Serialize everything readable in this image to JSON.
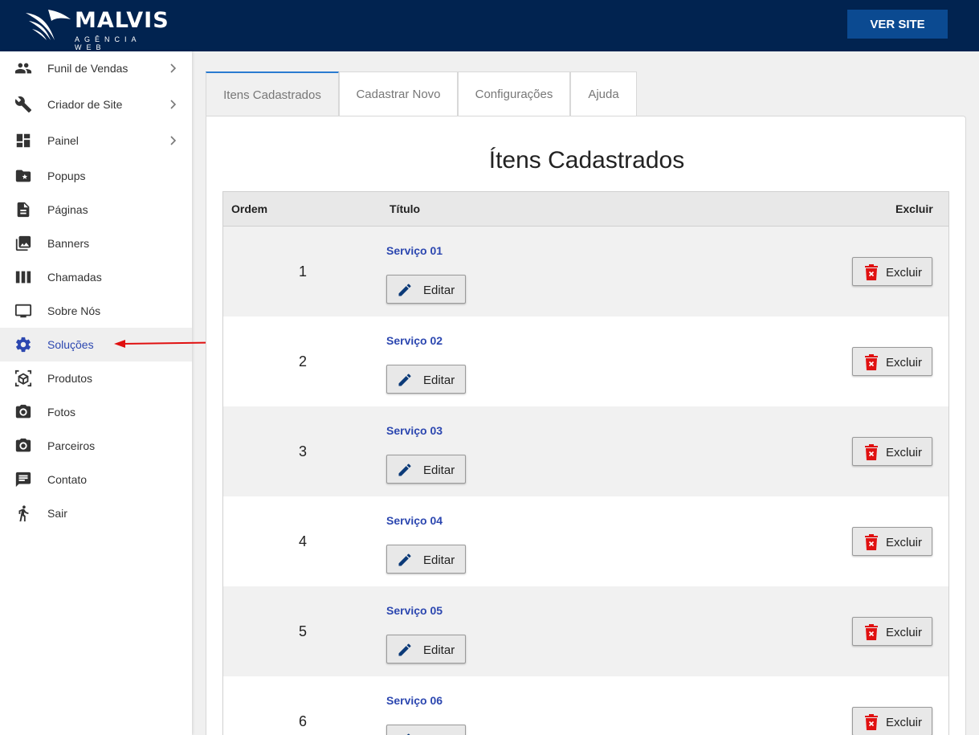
{
  "brand": {
    "name": "MALVIS",
    "tagline": "AGÊNCIA WEB"
  },
  "header": {
    "ver_site": "VER SITE"
  },
  "colors": {
    "topbar": "#012350",
    "accent": "#0b4a91",
    "link": "#2c47b0",
    "danger": "#e01010"
  },
  "sidebar": {
    "items": [
      {
        "label": "Funil de Vendas",
        "icon": "people-icon",
        "has_submenu": true
      },
      {
        "label": "Criador de Site",
        "icon": "wrench-icon",
        "has_submenu": true
      },
      {
        "label": "Painel",
        "icon": "dashboard-icon",
        "has_submenu": true
      },
      {
        "label": "Popups",
        "icon": "folder-star-icon"
      },
      {
        "label": "Páginas",
        "icon": "document-icon"
      },
      {
        "label": "Banners",
        "icon": "photo-library-icon"
      },
      {
        "label": "Chamadas",
        "icon": "columns-icon"
      },
      {
        "label": "Sobre Nós",
        "icon": "monitor-icon"
      },
      {
        "label": "Soluções",
        "icon": "gear-icon",
        "active": true
      },
      {
        "label": "Produtos",
        "icon": "cube-icon"
      },
      {
        "label": "Fotos",
        "icon": "camera-icon"
      },
      {
        "label": "Parceiros",
        "icon": "camera-icon"
      },
      {
        "label": "Contato",
        "icon": "chat-icon"
      },
      {
        "label": "Sair",
        "icon": "walk-icon"
      }
    ]
  },
  "tabs": [
    {
      "label": "Itens Cadastrados",
      "active": true
    },
    {
      "label": "Cadastrar Novo"
    },
    {
      "label": "Configurações"
    },
    {
      "label": "Ajuda"
    }
  ],
  "main": {
    "title": "Ítens Cadastrados",
    "columns": {
      "ordem": "Ordem",
      "titulo": "Título",
      "excluir": "Excluir"
    },
    "edit_label": "Editar",
    "delete_label": "Excluir",
    "rows": [
      {
        "ordem": "1",
        "titulo": "Serviço 01"
      },
      {
        "ordem": "2",
        "titulo": "Serviço 02"
      },
      {
        "ordem": "3",
        "titulo": "Serviço 03"
      },
      {
        "ordem": "4",
        "titulo": "Serviço 04"
      },
      {
        "ordem": "5",
        "titulo": "Serviço 05"
      },
      {
        "ordem": "6",
        "titulo": "Serviço 06"
      }
    ]
  }
}
